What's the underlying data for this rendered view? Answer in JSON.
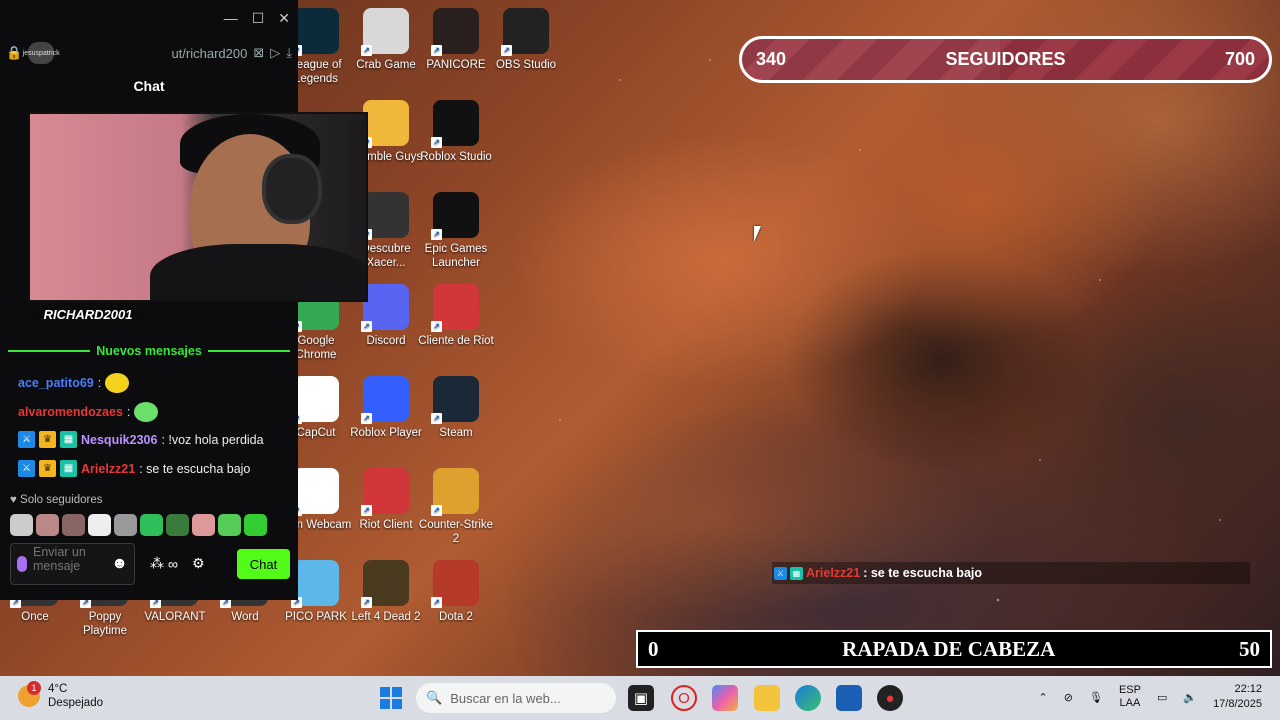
{
  "desktop_icons": [
    {
      "label": "League of Legends",
      "icon": "lol-icon",
      "color": "#0b2a3a"
    },
    {
      "label": "Crab Game",
      "icon": "crab-game-icon",
      "color": "#d8d8d8"
    },
    {
      "label": "PANICORE",
      "icon": "panicore-icon",
      "color": "#2a2020"
    },
    {
      "label": "OBS Studio",
      "icon": "obs-icon",
      "color": "#222"
    },
    {
      "label": "Stumble Guys",
      "icon": "stumble-guys-icon",
      "color": "#f0b73a"
    },
    {
      "label": "Roblox Studio",
      "icon": "roblox-studio-icon",
      "color": "#111"
    },
    {
      "label": "Descubre Xacer...",
      "icon": "acer-icon",
      "color": "#333"
    },
    {
      "label": "Epic Games Launcher",
      "icon": "epic-games-icon",
      "color": "#111"
    },
    {
      "label": "Google Chrome",
      "icon": "chrome-icon",
      "color": "#34a853"
    },
    {
      "label": "Discord",
      "icon": "discord-icon",
      "color": "#5865f2"
    },
    {
      "label": "Cliente de Riot",
      "icon": "riot-client-icon",
      "color": "#d13639"
    },
    {
      "label": "CapCut",
      "icon": "capcut-icon",
      "color": "#fff"
    },
    {
      "label": "Roblox Player",
      "icon": "roblox-player-icon",
      "color": "#335fff"
    },
    {
      "label": "Steam",
      "icon": "steam-icon",
      "color": "#1b2838"
    },
    {
      "label": "Iriun Webcam",
      "icon": "iriun-icon",
      "color": "#fff"
    },
    {
      "label": "Riot Client",
      "icon": "riot-icon",
      "color": "#d13639"
    },
    {
      "label": "Counter-Strike 2",
      "icon": "cs2-icon",
      "color": "#e0a030"
    },
    {
      "label": "Once",
      "icon": "once-icon",
      "color": "#333"
    },
    {
      "label": "Poppy Playtime",
      "icon": "poppy-icon",
      "color": "#333"
    },
    {
      "label": "VALORANT",
      "icon": "valorant-icon",
      "color": "#333"
    },
    {
      "label": "Word",
      "icon": "word-icon",
      "color": "#333"
    },
    {
      "label": "PICO PARK",
      "icon": "pico-park-icon",
      "color": "#5db7e8"
    },
    {
      "label": "Left 4 Dead 2",
      "icon": "l4d2-icon",
      "color": "#4a3a20"
    },
    {
      "label": "Dota 2",
      "icon": "dota2-icon",
      "color": "#b53a2a"
    }
  ],
  "chat": {
    "url": "ut/richard200",
    "avatar_text": "jesuspatrick",
    "title": "Chat",
    "streamer_name": "RICHARD2001",
    "new_messages_label": "Nuevos mensajes",
    "messages": [
      {
        "user": "ace_patito69",
        "user_color": "#4a7df7",
        "text": "",
        "badges": []
      },
      {
        "user": "alvaromendozaes",
        "user_color": "#e53935",
        "text": "",
        "badges": []
      },
      {
        "user": "Nesquik2306",
        "user_color": "#b993ff",
        "text": ": !voz hola perdida",
        "badges": [
          "blue",
          "gold",
          "teal"
        ]
      },
      {
        "user": "Arielzz21",
        "user_color": "#e53935",
        "text": ": se te escucha bajo",
        "badges": [
          "blue",
          "gold",
          "teal"
        ]
      }
    ],
    "followers_only": "Solo seguidores",
    "input_placeholder": "Enviar un mensaje",
    "send_label": "Chat"
  },
  "overlay": {
    "followers_current": "340",
    "followers_label": "SEGUIDORES",
    "followers_goal": "700",
    "followers_progress": 0.49,
    "chat_user": "Arielzz21",
    "chat_text": ": se te escucha bajo",
    "challenge_current": "0",
    "challenge_label": "RAPADA DE CABEZA",
    "challenge_goal": "50"
  },
  "taskbar": {
    "weather_temp": "4°C",
    "weather_desc": "Despejado",
    "weather_badge": "1",
    "search_placeholder": "Buscar en la web...",
    "lang_1": "ESP",
    "lang_2": "LAA",
    "time": "22:12",
    "date": "17/8/2025"
  }
}
